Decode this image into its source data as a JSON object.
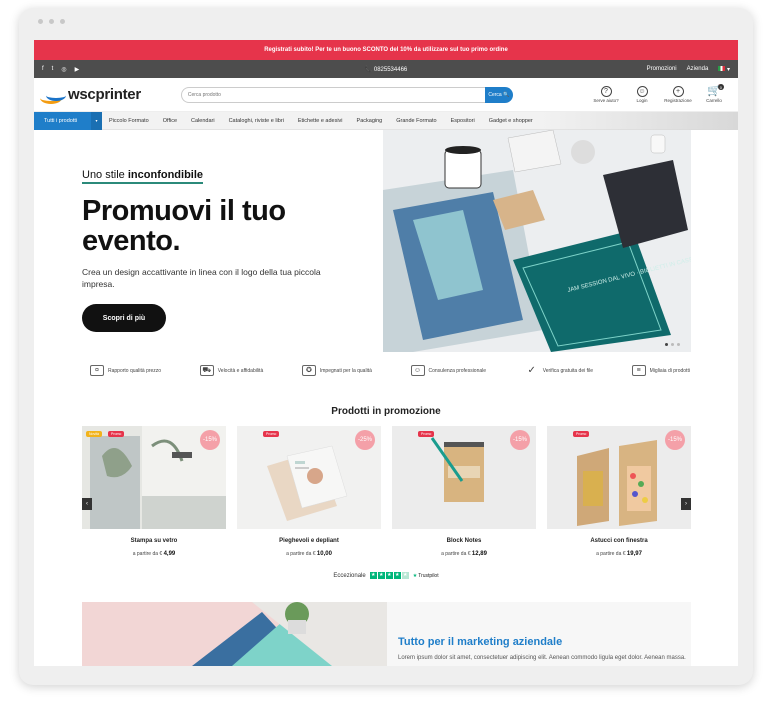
{
  "promo_bar": {
    "text": "Registrati subito! Per te un buono SCONTO del 10% da utilizzare sul tuo primo ordine"
  },
  "top_bar": {
    "phone": "📞 0825534466",
    "links": [
      "Promozioni",
      "Azienda"
    ]
  },
  "header": {
    "logo_text": "wscprinter",
    "search_placeholder": "Cerca prodotto",
    "search_button": "Cerca 🔍",
    "icons": [
      {
        "icon": "help-icon",
        "label": "Serve aiuto?"
      },
      {
        "icon": "user-icon",
        "label": "Login"
      },
      {
        "icon": "register-icon",
        "label": "Registrazione"
      },
      {
        "icon": "cart-icon",
        "label": "Carrello",
        "count": "0"
      }
    ]
  },
  "nav": {
    "all_label": "Tutti i prodotti",
    "items": [
      "Piccolo Formato",
      "Office",
      "Calendari",
      "Cataloghi, riviste e libri",
      "Etichette e adesivi",
      "Packaging",
      "Grande Formato",
      "Espositori",
      "Gadget e shopper"
    ]
  },
  "hero": {
    "kicker_normal": "Uno stile ",
    "kicker_bold": "inconfondibile",
    "title": "Promuovi il tuo evento.",
    "subtitle": "Crea un design accattivante in linea con il logo della tua piccola impresa.",
    "button": "Scopri di più",
    "poster_text": "JAM SESSION DAL VIVO · BIGLIETTI IN CASSA"
  },
  "features": [
    {
      "icon": "hand-coin-icon",
      "label": "Rapporto qualità prezzo"
    },
    {
      "icon": "truck-icon",
      "label": "Velocità e affidabilità"
    },
    {
      "icon": "medal-icon",
      "label": "Impegnati per la qualità"
    },
    {
      "icon": "support-icon",
      "label": "Consulenza professionale"
    },
    {
      "icon": "check-icon",
      "label": "Verifica gratuita dei file"
    },
    {
      "icon": "list-icon",
      "label": "Migliaia di prodotti"
    }
  ],
  "promo_section": {
    "title": "Prodotti in promozione",
    "products": [
      {
        "name": "Stampa su vetro",
        "price_prefix": "a partire da €",
        "price": "4,99",
        "discount": "-15%",
        "badges": [
          "Novità",
          "Promo"
        ]
      },
      {
        "name": "Pieghevoli e depliant",
        "price_prefix": "a partire da €",
        "price": "10,00",
        "discount": "-25%",
        "badges": [
          "Promo"
        ]
      },
      {
        "name": "Block Notes",
        "price_prefix": "a partire da €",
        "price": "12,89",
        "discount": "-15%",
        "badges": [
          "Promo"
        ]
      },
      {
        "name": "Astucci con finestra",
        "price_prefix": "a partire da €",
        "price": "19,97",
        "discount": "-15%",
        "badges": [
          "Promo"
        ]
      }
    ]
  },
  "trust": {
    "label": "Eccezionale",
    "brand": "Trustpilot"
  },
  "marketing": {
    "title": "Tutto per il marketing aziendale",
    "body": "Lorem ipsum dolor sit amet, consectetuer adipiscing elit. Aenean commodo ligula eget dolor. Aenean massa."
  }
}
